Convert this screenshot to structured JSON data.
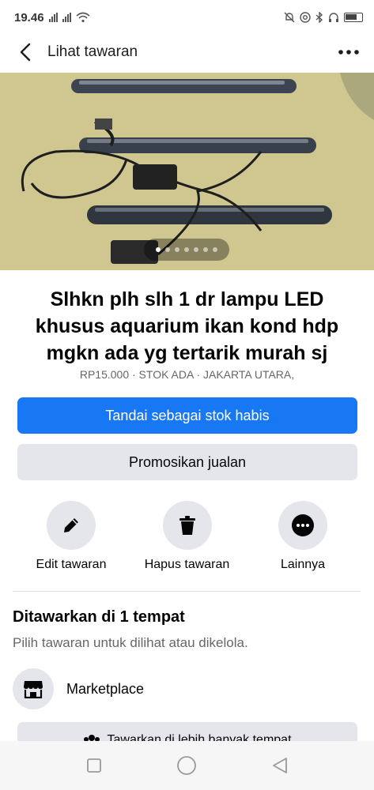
{
  "status_bar": {
    "time": "19.46"
  },
  "header": {
    "title": "Lihat tawaran",
    "back_icon": "chevron-left-icon",
    "more_icon": "more-horizontal-icon"
  },
  "listing": {
    "photo_count": 7,
    "active_photo": 1,
    "title": "Slhkn plh slh 1 dr lampu LED khusus aquarium ikan kond hdp mgkn ada yg tertarik murah sj",
    "meta": "RP15.000 · STOK ADA · JAKARTA UTARA,"
  },
  "buttons": {
    "mark_sold": "Tandai sebagai stok habis",
    "promote": "Promosikan jualan"
  },
  "actions": [
    {
      "label": "Edit tawaran",
      "icon": "pencil-icon"
    },
    {
      "label": "Hapus tawaran",
      "icon": "trash-icon"
    },
    {
      "label": "Lainnya",
      "icon": "more-horizontal-icon"
    }
  ],
  "offered": {
    "title": "Ditawarkan di 1 tempat",
    "subtitle": "Pilih tawaran untuk dilihat atau dikelola.",
    "place": "Marketplace",
    "more_places": "Tawarkan di lebih banyak tempat"
  },
  "colors": {
    "primary": "#1877f2",
    "secondary_bg": "#e4e6eb",
    "muted_text": "#65676b"
  }
}
